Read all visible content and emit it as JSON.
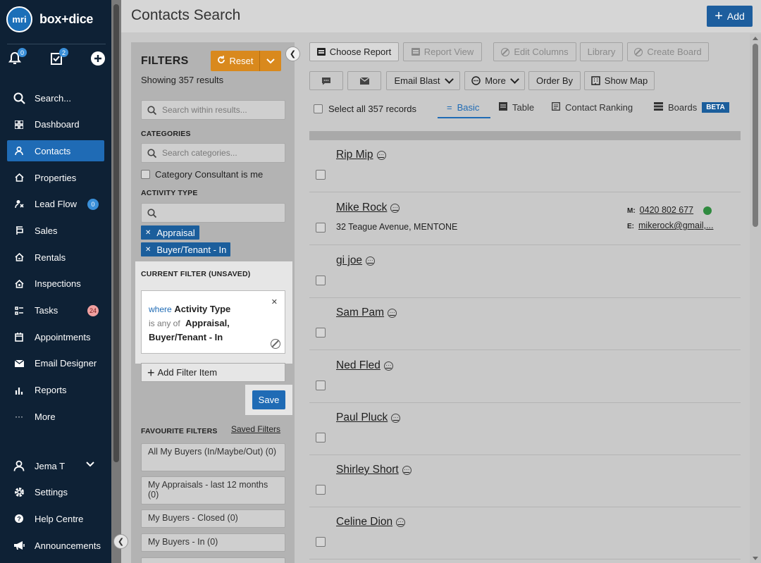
{
  "app": {
    "logo_mark": "mri",
    "logo_text": "box+dice"
  },
  "sidebar": {
    "notifications_count": "0",
    "tasks_count": "2",
    "items": [
      {
        "label": "Search...",
        "icon": "search-icon"
      },
      {
        "label": "Dashboard",
        "icon": "dashboard-icon"
      },
      {
        "label": "Contacts",
        "icon": "contacts-icon",
        "active": true
      },
      {
        "label": "Properties",
        "icon": "properties-icon"
      },
      {
        "label": "Lead Flow",
        "icon": "lead-flow-icon",
        "count": "0"
      },
      {
        "label": "Sales",
        "icon": "sales-icon"
      },
      {
        "label": "Rentals",
        "icon": "rentals-icon"
      },
      {
        "label": "Inspections",
        "icon": "inspections-icon"
      },
      {
        "label": "Tasks",
        "icon": "tasks-icon",
        "count": "24"
      },
      {
        "label": "Appointments",
        "icon": "appointments-icon"
      },
      {
        "label": "Email Designer",
        "icon": "email-icon"
      },
      {
        "label": "Reports",
        "icon": "reports-icon"
      },
      {
        "label": "More",
        "icon": "more-icon"
      }
    ],
    "bottom": [
      {
        "label": "Jema T",
        "icon": "user-icon"
      },
      {
        "label": "Settings",
        "icon": "gear-icon"
      },
      {
        "label": "Help Centre",
        "icon": "help-icon"
      },
      {
        "label": "Announcements",
        "icon": "megaphone-icon"
      }
    ]
  },
  "header": {
    "title": "Contacts Search",
    "add_label": "Add"
  },
  "filters": {
    "title": "FILTERS",
    "reset_label": "Reset",
    "showing": "Showing 357 results",
    "search_placeholder": "Search within results...",
    "categories_label": "CATEGORIES",
    "categories_placeholder": "Search categories...",
    "category_consultant_label": "Category Consultant is me",
    "activity_type_label": "ACTIVITY TYPE",
    "activity_chips": [
      "Appraisal",
      "Buyer/Tenant - In"
    ],
    "current_filter_label": "CURRENT FILTER (UNSAVED)",
    "current_filter": {
      "where": "where",
      "field": "Activity Type",
      "op": "is any of",
      "values": "Appraisal,",
      "values2": "Buyer/Tenant - In"
    },
    "add_filter_label": "Add Filter Item",
    "save_label": "Save",
    "favourite_label": "FAVOURITE FILTERS",
    "saved_filters_link": "Saved Filters",
    "favourites": [
      "All My Buyers (In/Maybe/Out) (0)",
      "My Appraisals - last 12 months (0)",
      "My Buyers - Closed (0)",
      "My Buyers - In (0)"
    ]
  },
  "toolbar": {
    "choose_report": "Choose Report",
    "report_view": "Report View",
    "edit_columns": "Edit Columns",
    "library": "Library",
    "create_board": "Create Board",
    "email_blast": "Email Blast",
    "more": "More",
    "order_by": "Order By",
    "show_map": "Show Map"
  },
  "views": {
    "select_all": "Select all 357 records",
    "basic": "Basic",
    "table": "Table",
    "contact_ranking": "Contact Ranking",
    "boards": "Boards",
    "beta": "BETA"
  },
  "contacts": [
    {
      "name": "Rip Mip",
      "address": ""
    },
    {
      "name": "Mike Rock",
      "address": "32 Teague Avenue, MENTONE",
      "mobile_label": "M:",
      "mobile": "0420 802 677",
      "email_label": "E:",
      "email": "mikerock@gmail,..."
    },
    {
      "name": "gi joe",
      "address": ""
    },
    {
      "name": "Sam Pam",
      "address": ""
    },
    {
      "name": "Ned Fled",
      "address": ""
    },
    {
      "name": "Paul Pluck",
      "address": ""
    },
    {
      "name": "Shirley Short",
      "address": ""
    },
    {
      "name": "Celine Dion",
      "address": ""
    }
  ],
  "colors": {
    "sidebar": "#0e2135",
    "accent": "#1f6bb5",
    "reset": "#d9891d"
  }
}
